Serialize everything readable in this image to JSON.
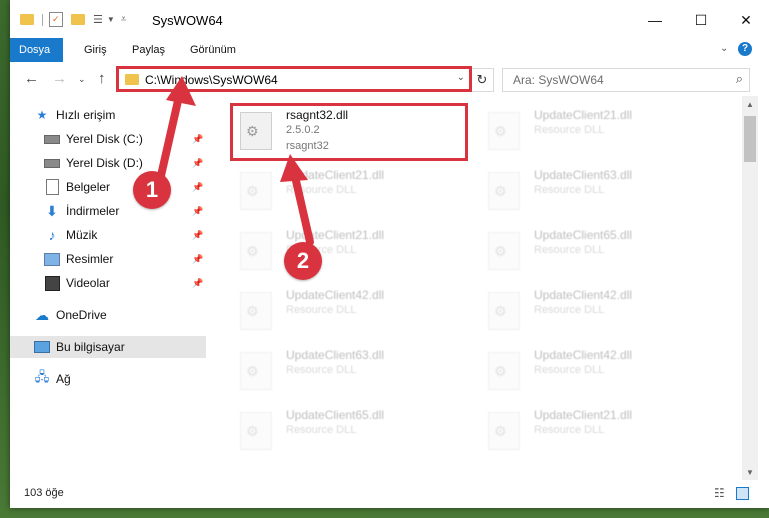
{
  "window": {
    "title": "SysWOW64",
    "minimize": "—",
    "maximize": "☐",
    "close": "✕"
  },
  "ribbon": {
    "tabs": [
      "Dosya",
      "Giriş",
      "Paylaş",
      "Görünüm"
    ],
    "help": "?"
  },
  "nav": {
    "address": "C:\\Windows\\SysWOW64",
    "search_placeholder": "Ara: SysWOW64"
  },
  "sidebar": {
    "items": [
      {
        "label": "Hızlı erişim",
        "icon": "star-icon",
        "pinned": false
      },
      {
        "label": "Yerel Disk (C:)",
        "icon": "drive-icon",
        "pinned": true
      },
      {
        "label": "Yerel Disk (D:)",
        "icon": "drive-icon",
        "pinned": true
      },
      {
        "label": "Belgeler",
        "icon": "documents-icon",
        "pinned": true
      },
      {
        "label": "İndirmeler",
        "icon": "download-icon",
        "pinned": true
      },
      {
        "label": "Müzik",
        "icon": "music-icon",
        "pinned": true
      },
      {
        "label": "Resimler",
        "icon": "pictures-icon",
        "pinned": true
      },
      {
        "label": "Videolar",
        "icon": "video-icon",
        "pinned": true
      },
      {
        "label": "OneDrive",
        "icon": "cloud-icon",
        "pinned": false
      },
      {
        "label": "Bu bilgisayar",
        "icon": "computer-icon",
        "pinned": false
      },
      {
        "label": "Ağ",
        "icon": "network-icon",
        "pinned": false
      }
    ]
  },
  "files": [
    {
      "name": "rsagnt32.dll",
      "line2": "2.5.0.2",
      "line3": "rsagnt32",
      "highlight": true
    },
    {
      "name": "UpdateClient21.dll",
      "line2": "Resource DLL"
    },
    {
      "name": "UpdateClient21.dll",
      "line2": "Resource DLL"
    },
    {
      "name": "UpdateClient63.dll",
      "line2": "Resource DLL"
    },
    {
      "name": "UpdateClient21.dll",
      "line2": "Resource DLL"
    },
    {
      "name": "UpdateClient65.dll",
      "line2": "Resource DLL"
    },
    {
      "name": "UpdateClient42.dll",
      "line2": "Resource DLL"
    },
    {
      "name": "UpdateClient42.dll",
      "line2": "Resource DLL"
    },
    {
      "name": "UpdateClient63.dll",
      "line2": "Resource DLL"
    },
    {
      "name": "UpdateClient42.dll",
      "line2": "Resource DLL"
    },
    {
      "name": "UpdateClient65.dll",
      "line2": "Resource DLL"
    },
    {
      "name": "UpdateClient21.dll",
      "line2": "Resource DLL"
    }
  ],
  "status": {
    "count": "103 öğe"
  },
  "annotations": {
    "step1": "1",
    "step2": "2"
  },
  "colors": {
    "accent": "#1979ca",
    "highlight": "#d9333f",
    "selected": "#e5e5e5"
  }
}
